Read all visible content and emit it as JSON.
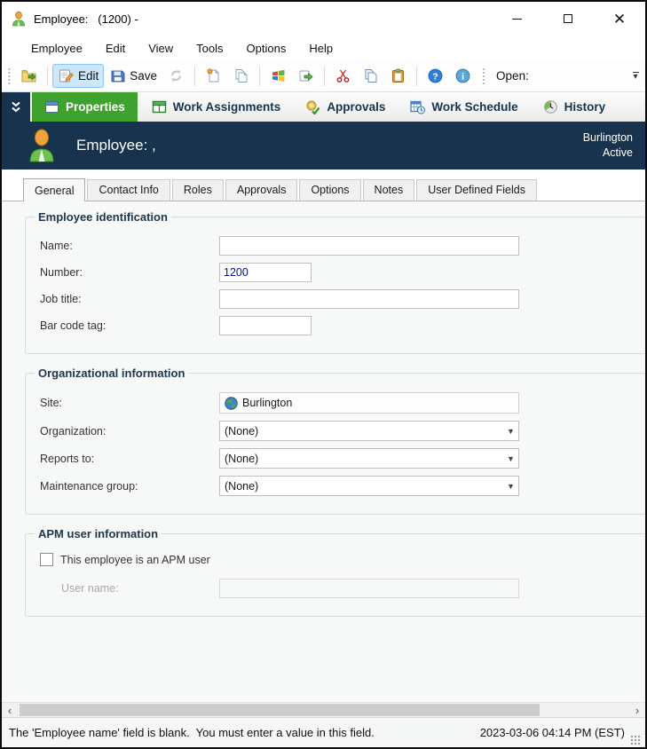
{
  "window": {
    "title": "Employee:   (1200) - ",
    "app_icon": "employee-person-icon"
  },
  "menu": {
    "items": [
      "Employee",
      "Edit",
      "View",
      "Tools",
      "Options",
      "Help"
    ]
  },
  "toolbar": {
    "edit_label": "Edit",
    "save_label": "Save",
    "open_label": "Open:",
    "icons": [
      "open-folder-icon",
      "edit-icon",
      "save-icon",
      "refresh-icon",
      "new-document-icon",
      "duplicate-document-icon",
      "windows-logo-icon",
      "send-icon",
      "cut-icon",
      "copy-icon",
      "paste-icon",
      "help-icon",
      "info-icon",
      "toolbar-overflow-icon"
    ]
  },
  "feature_tabs": {
    "items": [
      {
        "label": "Properties",
        "icon": "window-icon",
        "active": true
      },
      {
        "label": "Work Assignments",
        "icon": "table-grid-icon",
        "active": false
      },
      {
        "label": "Approvals",
        "icon": "approval-check-icon",
        "active": false
      },
      {
        "label": "Work Schedule",
        "icon": "calendar-clock-icon",
        "active": false
      },
      {
        "label": "History",
        "icon": "history-clock-icon",
        "active": false
      }
    ]
  },
  "banner": {
    "title": "Employee: ,",
    "site": "Burlington",
    "status": "Active",
    "accent_color": "#17334d"
  },
  "page_tabs": {
    "items": [
      "General",
      "Contact Info",
      "Roles",
      "Approvals",
      "Options",
      "Notes",
      "User Defined Fields"
    ],
    "active": "General"
  },
  "sections": {
    "identification": {
      "legend": "Employee identification",
      "fields": [
        {
          "label": "Name:",
          "value": "",
          "width": "wide"
        },
        {
          "label": "Number:",
          "value": "1200",
          "width": "narrow"
        },
        {
          "label": "Job title:",
          "value": "",
          "width": "wide"
        },
        {
          "label": "Bar code tag:",
          "value": "",
          "width": "narrow"
        }
      ]
    },
    "organization": {
      "legend": "Organizational information",
      "site_label": "Site:",
      "site_value": "Burlington",
      "site_icon": "globe-icon",
      "combos": [
        {
          "label": "Organization:",
          "value": "(None)"
        },
        {
          "label": "Reports to:",
          "value": "(None)"
        },
        {
          "label": "Maintenance group:",
          "value": "(None)"
        }
      ]
    },
    "apm": {
      "legend": "APM user information",
      "checkbox_label": "This employee is an APM user",
      "checked": false,
      "username_label": "User name:",
      "username_value": ""
    }
  },
  "status_bar": {
    "message": "The 'Employee name' field is blank.  You must enter a value in this field.",
    "timestamp": "2023-03-06 04:14 PM (EST)",
    "highlight_colors": {
      "active_tab_green": "#3fa22e",
      "navy": "#17344e"
    }
  }
}
